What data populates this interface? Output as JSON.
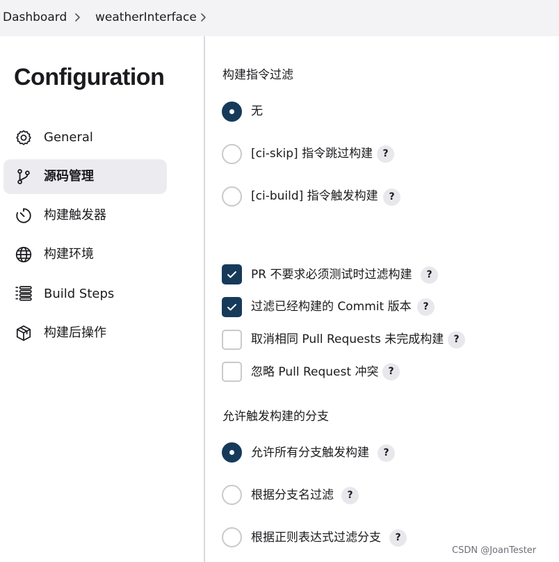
{
  "breadcrumb": {
    "items": [
      "Dashboard",
      "weatherInterface"
    ]
  },
  "sidebar": {
    "title": "Configuration",
    "items": [
      {
        "label": "General",
        "icon": "gear-icon",
        "active": false
      },
      {
        "label": "源码管理",
        "icon": "source-branch-icon",
        "active": true
      },
      {
        "label": "构建触发器",
        "icon": "timer-icon",
        "active": false
      },
      {
        "label": "构建环境",
        "icon": "globe-icon",
        "active": false
      },
      {
        "label": "Build Steps",
        "icon": "list-icon",
        "active": false
      },
      {
        "label": "构建后操作",
        "icon": "package-icon",
        "active": false
      }
    ]
  },
  "content": {
    "filter_section": {
      "title": "构建指令过滤",
      "options": [
        {
          "label": "无",
          "checked": true,
          "help": false
        },
        {
          "label": "[ci-skip] 指令跳过构建",
          "checked": false,
          "help": true
        },
        {
          "label": "[ci-build] 指令触发构建",
          "checked": false,
          "help": true
        }
      ]
    },
    "checkboxes": [
      {
        "label": "PR 不要求必须测试时过滤构建",
        "checked": true
      },
      {
        "label": "过滤已经构建的 Commit 版本",
        "checked": true
      },
      {
        "label": "取消相同 Pull Requests 未完成构建",
        "checked": false
      },
      {
        "label": "忽略 Pull Request 冲突",
        "checked": false
      }
    ],
    "branch_section": {
      "title": "允许触发构建的分支",
      "options": [
        {
          "label": "允许所有分支触发构建",
          "checked": true
        },
        {
          "label": "根据分支名过滤",
          "checked": false
        },
        {
          "label": "根据正则表达式过滤分支",
          "checked": false
        }
      ]
    },
    "help_symbol": "?"
  },
  "colors": {
    "accent": "#163a5a",
    "topbar": "#f3f3f6",
    "active_nav": "#ececf0"
  },
  "watermark": "CSDN @JoanTester"
}
